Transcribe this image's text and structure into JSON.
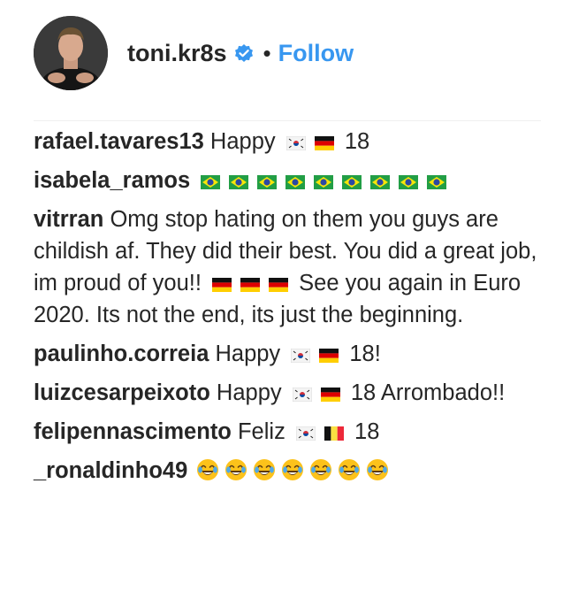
{
  "header": {
    "username": "toni.kr8s",
    "separator": "•",
    "follow_label": "Follow",
    "accent_color": "#3897f0"
  },
  "comments": [
    {
      "user": "rafael.tavares13",
      "text_before": "Happy",
      "emojis": [
        "flag-south-korea",
        "flag-germany"
      ],
      "text_after": "18"
    },
    {
      "user": "isabela_ramos",
      "text_before": "",
      "emojis": [
        "flag-brazil",
        "flag-brazil",
        "flag-brazil",
        "flag-brazil",
        "flag-brazil",
        "flag-brazil",
        "flag-brazil",
        "flag-brazil",
        "flag-brazil"
      ],
      "text_after": ""
    },
    {
      "user": "vitrran",
      "text_before": "Omg stop hating on them you guys are childish af. They did their best. You did a great job, im proud of you!!",
      "emojis": [
        "flag-germany",
        "flag-germany",
        "flag-germany"
      ],
      "text_after": " See you again in Euro 2020. Its not the end, its just the beginning."
    },
    {
      "user": "paulinho.correia",
      "text_before": "Happy",
      "emojis": [
        "flag-south-korea",
        "flag-germany"
      ],
      "text_after": "18!"
    },
    {
      "user": "luizcesarpeixoto",
      "text_before": "Happy",
      "emojis": [
        "flag-south-korea",
        "flag-germany"
      ],
      "text_after": "18 Arrombado!!"
    },
    {
      "user": "felipennascimento",
      "text_before": "Feliz",
      "emojis": [
        "flag-south-korea",
        "flag-belgium"
      ],
      "text_after": "18"
    },
    {
      "user": "_ronaldinho49",
      "text_before": "",
      "emojis": [
        "laughing-emoji",
        "laughing-emoji",
        "laughing-emoji",
        "laughing-emoji",
        "laughing-emoji",
        "laughing-emoji",
        "laughing-emoji"
      ],
      "text_after": ""
    }
  ]
}
